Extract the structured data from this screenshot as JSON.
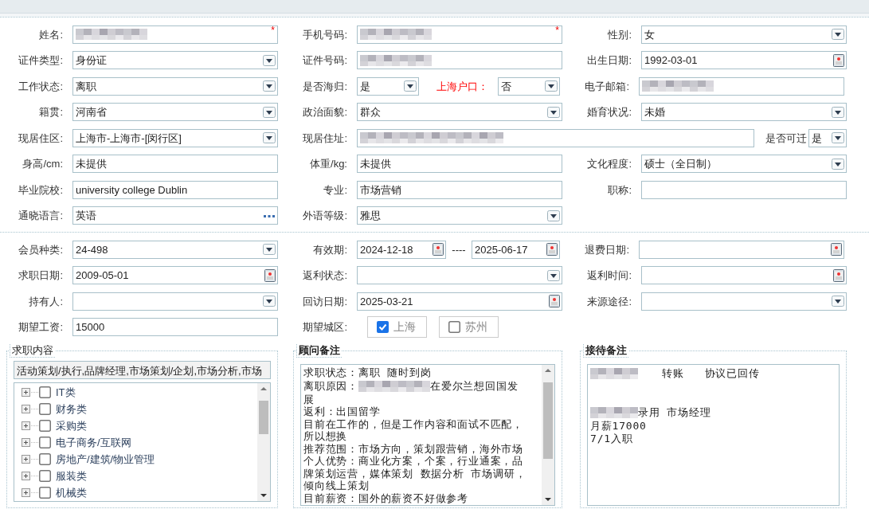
{
  "sections": [
    {
      "rows": [
        [
          {
            "label": "姓名:",
            "kind": "text",
            "redacted": true,
            "required_mark": "*"
          },
          {
            "label": "手机号码:",
            "kind": "text",
            "redacted": true,
            "required_mark": "*"
          },
          {
            "label": "性别:",
            "kind": "select",
            "value": "女"
          }
        ],
        [
          {
            "label": "证件类型:",
            "kind": "select",
            "value": "身份证"
          },
          {
            "label": "证件号码:",
            "kind": "text",
            "redacted": true
          },
          {
            "label": "出生日期:",
            "kind": "date",
            "value": "1992-03-01"
          }
        ],
        [
          {
            "label": "工作状态:",
            "kind": "select",
            "value": "离职"
          },
          {
            "label": "是否海归:",
            "kind": "short_select",
            "value": "是"
          },
          {
            "label": "上海户口：",
            "kind": "short_select",
            "value": "否",
            "highlight": true
          },
          {
            "label": "电子邮箱:",
            "kind": "text",
            "redacted": true
          }
        ],
        [
          {
            "label": "籍贯:",
            "kind": "select",
            "value": "河南省"
          },
          {
            "label": "政治面貌:",
            "kind": "select",
            "value": "群众"
          },
          {
            "label": "婚育状况:",
            "kind": "select",
            "value": "未婚"
          }
        ],
        [
          {
            "label": "现居住区:",
            "kind": "select",
            "value": "上海市-上海市-[闵行区]"
          },
          {
            "label": "现居住址:",
            "kind": "wide_text",
            "redacted": true
          },
          {
            "label": "是否可迁",
            "kind": "tiny_select",
            "value": "是"
          }
        ],
        [
          {
            "label": "身高/cm:",
            "kind": "text",
            "value": "未提供"
          },
          {
            "label": "体重/kg:",
            "kind": "text",
            "value": "未提供"
          },
          {
            "label": "文化程度:",
            "kind": "select",
            "value": "硕士（全日制）"
          }
        ],
        [
          {
            "label": "毕业院校:",
            "kind": "text",
            "value": "university college Dublin"
          },
          {
            "label": "专业:",
            "kind": "text",
            "value": "市场营销"
          },
          {
            "label": "职称:",
            "kind": "text"
          }
        ],
        [
          {
            "label": "通晓语言:",
            "kind": "lookup",
            "value": "英语"
          },
          {
            "label": "外语等级:",
            "kind": "select",
            "value": "雅思"
          }
        ]
      ]
    },
    {
      "rows": [
        [
          {
            "label": "会员种类:",
            "kind": "select",
            "value": "24-498"
          },
          {
            "label": "有效期:",
            "kind": "date_range",
            "value": "2024-12-18",
            "separator": "----",
            "value_end": "2025-06-17"
          },
          {
            "label": "退费日期:",
            "kind": "date"
          }
        ],
        [
          {
            "label": "求职日期:",
            "kind": "date",
            "value": "2009-05-01"
          },
          {
            "label": "返利状态:",
            "kind": "select"
          },
          {
            "label": "返利时间:",
            "kind": "date"
          }
        ],
        [
          {
            "label": "持有人:",
            "kind": "select"
          },
          {
            "label": "回访日期:",
            "kind": "date",
            "value": "2025-03-21"
          },
          {
            "label": "来源途径:",
            "kind": "select"
          }
        ],
        [
          {
            "label": "期望工资:",
            "kind": "text",
            "value": "15000"
          },
          {
            "label": "期望城区:",
            "kind": "checks",
            "options": [
              {
                "label": "上海",
                "checked": true
              },
              {
                "label": "苏州",
                "checked": false
              }
            ]
          }
        ]
      ]
    }
  ],
  "panels": [
    {
      "kind": "tree",
      "legend": "求职内容",
      "legend_bold": false,
      "summary": "活动策划/执行,品牌经理,市场策划/企划,市场分析,市场",
      "tree": [
        {
          "label": "IT类",
          "checked": false
        },
        {
          "label": "财务类",
          "checked": false
        },
        {
          "label": "采购类",
          "checked": false
        },
        {
          "label": "电子商务/互联网",
          "checked": false
        },
        {
          "label": "房地产/建筑/物业管理",
          "checked": false
        },
        {
          "label": "服装类",
          "checked": false
        },
        {
          "label": "机械类",
          "checked": false
        }
      ]
    },
    {
      "kind": "notes",
      "legend": "顾问备注",
      "legend_bold": true,
      "scrollable": true,
      "lines": [
        {
          "parts": [
            {
              "text": "求职状态：离职 随时到岗"
            }
          ]
        },
        {
          "parts": [
            {
              "text": "离职原因："
            },
            {
              "redacted": true
            },
            {
              "text": " 在爱尔兰想回国发"
            }
          ]
        },
        {
          "parts": [
            {
              "text": "展"
            }
          ]
        },
        {
          "parts": [
            {
              "text": "返利：出国留学"
            }
          ]
        },
        {
          "parts": [
            {
              "text": "目前在工作的，但是工作内容和面试不匹配，"
            }
          ]
        },
        {
          "parts": [
            {
              "text": "所以想换"
            }
          ]
        },
        {
          "parts": [
            {
              "text": "推荐范围：市场方向，策划跟营销，海外市场"
            }
          ]
        },
        {
          "parts": [
            {
              "text": "个人优势：商业化方案，个案，行业通案，品"
            }
          ]
        },
        {
          "parts": [
            {
              "text": "牌策划运营，媒体策划 数据分析 市场调研，"
            }
          ]
        },
        {
          "parts": [
            {
              "text": "倾向线上策划"
            }
          ]
        },
        {
          "parts": [
            {
              "text": "目前薪资：国外的薪资不好做参考"
            }
          ]
        }
      ]
    },
    {
      "kind": "notes",
      "legend": "接待备注",
      "legend_bold": true,
      "scrollable": false,
      "lines": [
        {
          "parts": [
            {
              "redacted": true
            },
            {
              "text": "转账"
            },
            {
              "text": "协议已回传"
            }
          ]
        },
        {
          "parts": [
            {
              "redacted": true
            },
            {
              "text": "录用 市场经理"
            }
          ],
          "spaced": true
        },
        {
          "parts": [
            {
              "text": "月薪17000"
            }
          ]
        },
        {
          "parts": [
            {
              "text": "7/1入职"
            }
          ]
        }
      ]
    }
  ]
}
